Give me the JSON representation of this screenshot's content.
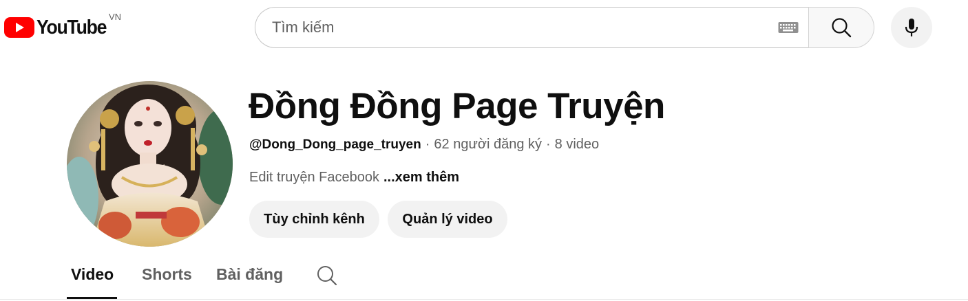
{
  "header": {
    "logo_text": "YouTube",
    "country_code": "VN",
    "brand_color": "#ff0000",
    "search_placeholder": "Tìm kiếm",
    "icons": [
      "youtube-logo-icon",
      "keyboard-icon",
      "search-icon",
      "microphone-icon"
    ]
  },
  "channel": {
    "name": "Đồng Đồng Page Truyện",
    "handle": "@Dong_Dong_page_truyen",
    "separator": "·",
    "subscribers": "62 người đăng ký",
    "video_count": "8 video",
    "description": "Edit truyện Facebook",
    "more_label": "...xem thêm",
    "buttons": {
      "customize": "Tùy chỉnh kênh",
      "manage": "Quản lý video"
    }
  },
  "tabs": [
    {
      "label": "Video",
      "active": true
    },
    {
      "label": "Shorts",
      "active": false
    },
    {
      "label": "Bài đăng",
      "active": false
    }
  ]
}
